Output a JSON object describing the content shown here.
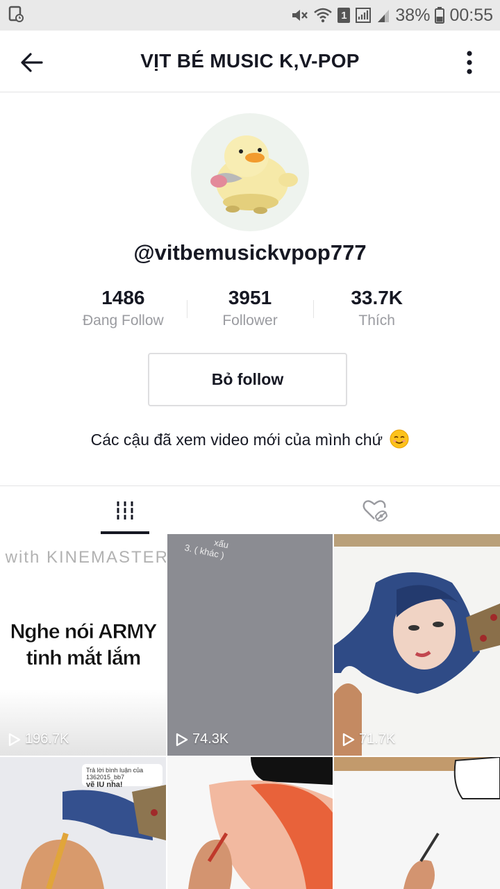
{
  "status_bar": {
    "battery": "38%",
    "time": "00:55",
    "sim": "1"
  },
  "header": {
    "title": "VỊT BÉ MUSIC K,V-POP"
  },
  "profile": {
    "handle": "@vitbemusickvpop777",
    "stats": [
      {
        "value": "1486",
        "label": "Đang Follow"
      },
      {
        "value": "3951",
        "label": "Follower"
      },
      {
        "value": "33.7K",
        "label": "Thích"
      }
    ],
    "unfollow_label": "Bỏ follow",
    "bio": "Các cậu đã xem video mới của mình chứ"
  },
  "tabs": [
    {
      "icon": "grid-icon",
      "active": true
    },
    {
      "icon": "liked-hidden-icon",
      "active": false
    }
  ],
  "videos": [
    {
      "views": "196.7K",
      "watermark": "Made with KINEMASTER",
      "caption_line1": "Nghe nói ARMY",
      "caption_line2": "tinh mắt lắm"
    },
    {
      "views": "74.3K",
      "overlay_text_line1": "xấu",
      "overlay_text_line2": "3. ( khác )"
    },
    {
      "views": "71.7K"
    },
    {
      "comment_header": "Trả lời bình luận của 1362015_bb7",
      "comment_text": "vẽ IU nha!"
    },
    {},
    {}
  ],
  "colors": {
    "accent_text": "#161823",
    "secondary_text": "#9a9ba0",
    "status_bar_bg": "#e9e9e9"
  }
}
